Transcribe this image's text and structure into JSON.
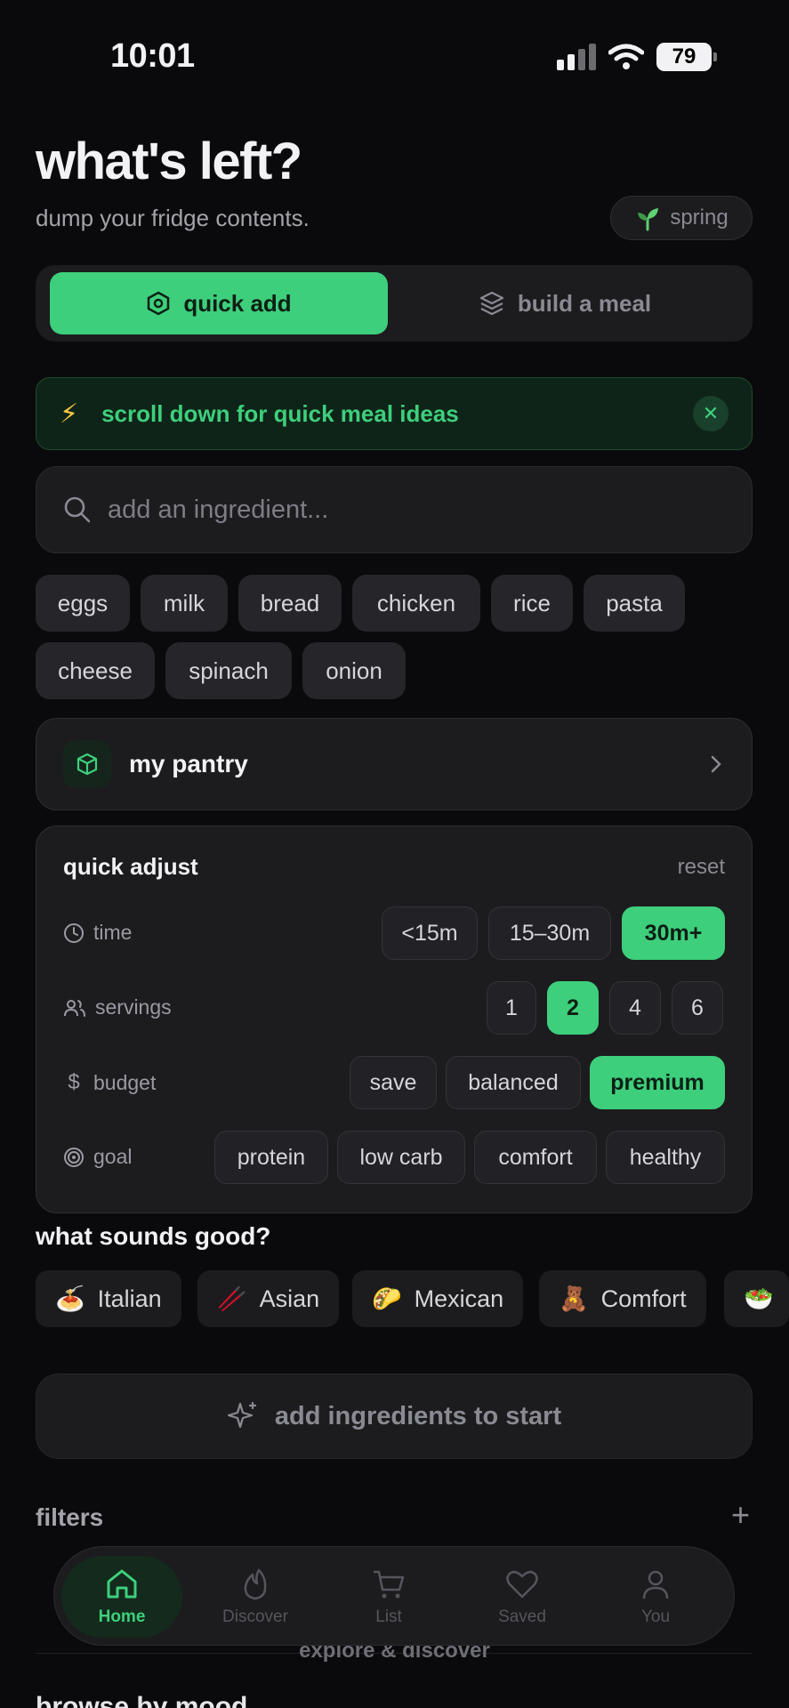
{
  "status_bar": {
    "time": "10:01",
    "battery": "79"
  },
  "header": {
    "title": "what's left?",
    "subtitle": "dump your fridge contents.",
    "season": "spring"
  },
  "mode_toggle": {
    "quick_add": "quick add",
    "build_meal": "build a meal"
  },
  "tip": {
    "text": "scroll down for quick meal ideas"
  },
  "search": {
    "placeholder": "add an ingredient..."
  },
  "ingredients": [
    "eggs",
    "milk",
    "bread",
    "chicken",
    "rice",
    "pasta",
    "cheese",
    "spinach",
    "onion"
  ],
  "pantry": {
    "label": "my pantry"
  },
  "quick_adjust": {
    "title": "quick adjust",
    "reset": "reset",
    "time": {
      "label": "time",
      "options": [
        "<15m",
        "15–30m",
        "30m+"
      ],
      "selected": "30m+"
    },
    "servings": {
      "label": "servings",
      "options": [
        "1",
        "2",
        "4",
        "6"
      ],
      "selected": "2"
    },
    "budget": {
      "label": "budget",
      "options": [
        "save",
        "balanced",
        "premium"
      ],
      "selected": "premium"
    },
    "goal": {
      "label": "goal",
      "options": [
        "protein",
        "low carb",
        "comfort",
        "healthy"
      ],
      "selected": ""
    }
  },
  "cuisines": {
    "title": "what sounds good?",
    "items": [
      {
        "emoji": "🍝",
        "label": "Italian"
      },
      {
        "emoji": "🥢",
        "label": "Asian"
      },
      {
        "emoji": "🌮",
        "label": "Mexican"
      },
      {
        "emoji": "🧸",
        "label": "Comfort"
      },
      {
        "emoji": "🥗",
        "label": ""
      }
    ]
  },
  "cta": {
    "label": "add ingredients to start"
  },
  "filters": {
    "label": "filters",
    "add": "+"
  },
  "explore": {
    "label": "explore & discover",
    "browse": "browse by mood"
  },
  "tabbar": {
    "tabs": [
      {
        "label": "Home",
        "icon": "home-icon"
      },
      {
        "label": "Discover",
        "icon": "flame-icon"
      },
      {
        "label": "List",
        "icon": "cart-icon"
      },
      {
        "label": "Saved",
        "icon": "heart-icon"
      },
      {
        "label": "You",
        "icon": "user-icon"
      }
    ],
    "active": "Home"
  },
  "colors": {
    "accent": "#3ecf7c",
    "background": "#0a0a0c",
    "card": "#1c1c1f"
  }
}
